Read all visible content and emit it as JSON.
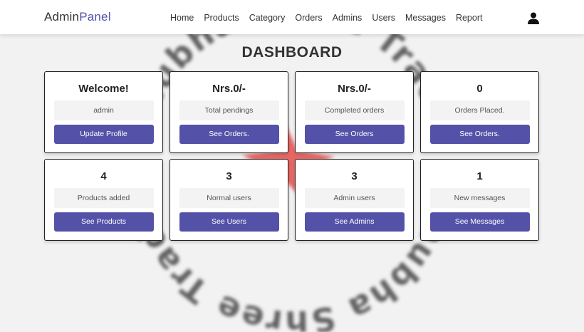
{
  "header": {
    "logo_part1": "Admin",
    "logo_part2": "Panel",
    "nav": [
      "Home",
      "Products",
      "Category",
      "Orders",
      "Admins",
      "Users",
      "Messages",
      "Report"
    ],
    "user_icon": "user-icon"
  },
  "watermark": {
    "text": "Shubha Shree Trade",
    "color": "#e53935"
  },
  "page_title": "DASHBOARD",
  "cards": [
    {
      "heading": "Welcome!",
      "info": "admin",
      "button": "Update Profile"
    },
    {
      "heading": "Nrs.0/-",
      "info": "Total pendings",
      "button": "See Orders."
    },
    {
      "heading": "Nrs.0/-",
      "info": "Completed orders",
      "button": "See Orders"
    },
    {
      "heading": "0",
      "info": "Orders Placed.",
      "button": "See Orders."
    },
    {
      "heading": "4",
      "info": "Products added",
      "button": "See Products"
    },
    {
      "heading": "3",
      "info": "Normal users",
      "button": "See Users"
    },
    {
      "heading": "3",
      "info": "Admin users",
      "button": "See Admins"
    },
    {
      "heading": "1",
      "info": "New messages",
      "button": "See Messages"
    }
  ],
  "colors": {
    "accent": "#5452a8",
    "background": "#f2f2f2",
    "card_background": "#ffffff"
  }
}
